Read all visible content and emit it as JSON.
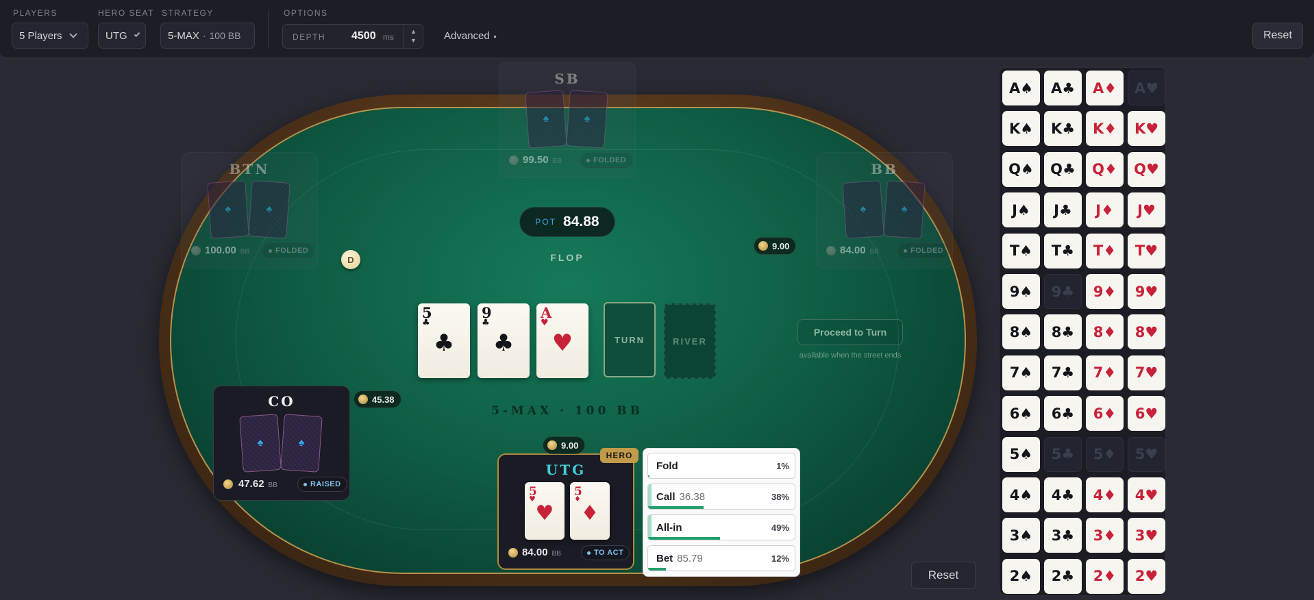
{
  "toolbar": {
    "players_label": "PLAYERS",
    "players_value": "5 Players",
    "hero_seat_label": "HERO SEAT",
    "hero_seat_value": "UTG",
    "strategy_label": "STRATEGY",
    "strategy_value": "5-MAX",
    "strategy_stack": "100 BB",
    "options_label": "OPTIONS",
    "depth_label": "DEPTH",
    "depth_value": "4500",
    "depth_unit": "ms",
    "advanced_label": "Advanced",
    "reset_label": "Reset"
  },
  "table": {
    "pot_label": "POT",
    "pot_value": "84.88",
    "street": "FLOP",
    "title": "5-MAX · 100 BB",
    "dealer_label": "D",
    "turn_label": "TURN",
    "river_label": "RIVER",
    "proceed_label": "Proceed to Turn",
    "proceed_hint": "available when the street ends",
    "reset_label": "Reset",
    "board": [
      {
        "rank": "5",
        "suit": "♣",
        "color": "black"
      },
      {
        "rank": "9",
        "suit": "♣",
        "color": "black"
      },
      {
        "rank": "A",
        "suit": "♥",
        "color": "red"
      }
    ]
  },
  "seats": {
    "sb": {
      "name": "SB",
      "stack": "99.50",
      "unit": "BB",
      "status": "FOLDED"
    },
    "btn": {
      "name": "BTN",
      "stack": "100.00",
      "unit": "BB",
      "status": "FOLDED"
    },
    "bb": {
      "name": "BB",
      "stack": "84.00",
      "unit": "BB",
      "status": "FOLDED",
      "bet": "9.00"
    },
    "co": {
      "name": "CO",
      "stack": "47.62",
      "unit": "BB",
      "status": "RAISED",
      "bet": "45.38"
    },
    "utg": {
      "name": "UTG",
      "stack": "84.00",
      "unit": "BB",
      "status": "TO ACT",
      "bet": "9.00",
      "badge": "HERO",
      "cards": [
        {
          "rank": "5",
          "suit": "♥",
          "color": "red"
        },
        {
          "rank": "5",
          "suit": "♦",
          "color": "red"
        }
      ]
    }
  },
  "actions": [
    {
      "label": "Fold",
      "amount": "",
      "pct": "1%",
      "freq": 1
    },
    {
      "label": "Call",
      "amount": "36.38",
      "pct": "38%",
      "freq": 38
    },
    {
      "label": "All-in",
      "amount": "",
      "pct": "49%",
      "freq": 49
    },
    {
      "label": "Bet",
      "amount": "85.79",
      "pct": "12%",
      "freq": 12
    }
  ],
  "card_grid": {
    "ranks": [
      "A",
      "K",
      "Q",
      "J",
      "T",
      "9",
      "8",
      "7",
      "6",
      "5",
      "4",
      "3",
      "2"
    ],
    "suits": [
      {
        "symbol": "♠",
        "color": "#15161c"
      },
      {
        "symbol": "♣",
        "color": "#15161c"
      },
      {
        "symbol": "♦",
        "color": "#c8213a"
      },
      {
        "symbol": "♥",
        "color": "#c8213a"
      }
    ],
    "used": [
      "A♥",
      "9♣",
      "5♣",
      "5♦",
      "5♥"
    ]
  },
  "colors": {
    "accent_teal": "#3fd0d8",
    "accent_blue": "#36a7e8",
    "felt": "#0f5e45",
    "gold": "#c19a4a",
    "bar_green": "#22a06b"
  }
}
